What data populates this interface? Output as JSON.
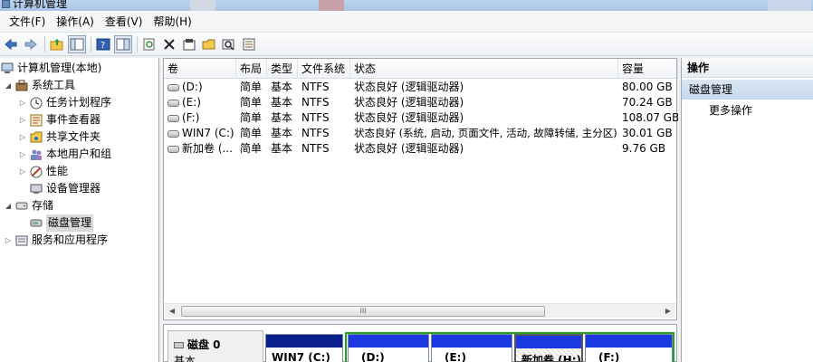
{
  "window": {
    "title": "计算机管理"
  },
  "menu": [
    "文件(F)",
    "操作(A)",
    "查看(V)",
    "帮助(H)"
  ],
  "toolbar_icons": [
    "back-arrow-icon",
    "forward-arrow-icon",
    "up-folder-icon",
    "show-tree-icon",
    "help-icon",
    "help-view-icon",
    "refresh-icon",
    "delete-icon",
    "properties-icon",
    "open-folder-icon",
    "search-icon",
    "export-icon"
  ],
  "tree": {
    "root": "计算机管理(本地)",
    "system_tools": "系统工具",
    "task_scheduler": "任务计划程序",
    "event_viewer": "事件查看器",
    "shared_folders": "共享文件夹",
    "local_users": "本地用户和组",
    "performance": "性能",
    "device_manager": "设备管理器",
    "storage": "存储",
    "disk_management": "磁盘管理",
    "services_apps": "服务和应用程序"
  },
  "volumes": {
    "columns": [
      "卷",
      "布局",
      "类型",
      "文件系统",
      "状态",
      "容量"
    ],
    "rows": [
      [
        "(D:)",
        "简单",
        "基本",
        "NTFS",
        "状态良好 (逻辑驱动器)",
        "80.00 GB"
      ],
      [
        "(E:)",
        "简单",
        "基本",
        "NTFS",
        "状态良好 (逻辑驱动器)",
        "70.24 GB"
      ],
      [
        "(F:)",
        "简单",
        "基本",
        "NTFS",
        "状态良好 (逻辑驱动器)",
        "108.07 GB"
      ],
      [
        "WIN7 (C:)",
        "简单",
        "基本",
        "NTFS",
        "状态良好 (系统, 启动, 页面文件, 活动, 故障转储, 主分区)",
        "30.01 GB"
      ],
      [
        "新加卷 (...",
        "简单",
        "基本",
        "NTFS",
        "状态良好 (逻辑驱动器)",
        "9.76 GB"
      ]
    ]
  },
  "scrollbar": {
    "thumb_grip": "III"
  },
  "disk": {
    "name": "磁盘 0",
    "type": "基本",
    "partitions": [
      {
        "label": "WIN7  (C:)",
        "color": "#0a1e8c"
      },
      {
        "label": "(D:)",
        "color": "#1c38e0"
      },
      {
        "label": "(E:)",
        "color": "#1c38e0"
      },
      {
        "label": "新加卷  (H:)",
        "color": "#1c38e0"
      },
      {
        "label": "(F:)",
        "color": "#1c38e0"
      }
    ],
    "extended_border_color": "#21a021"
  },
  "actions": {
    "header": "操作",
    "section": "磁盘管理",
    "more": "更多操作"
  }
}
